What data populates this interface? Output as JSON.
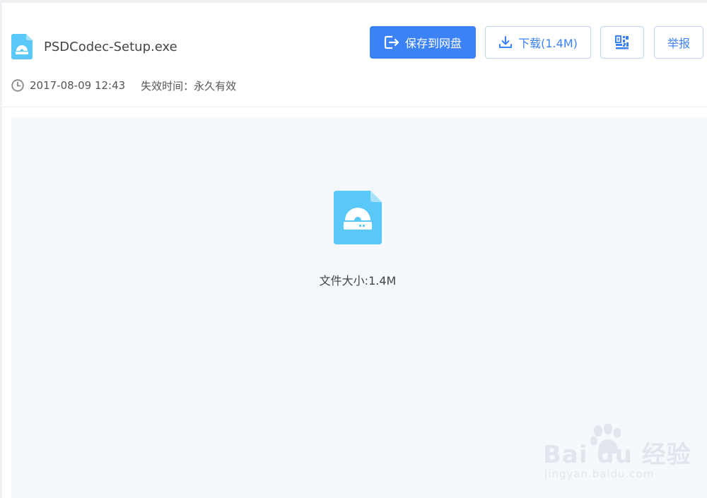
{
  "file": {
    "name": "PSDCodec-Setup.exe",
    "icon": "exe-file-icon",
    "date": "2017-08-09 12:43",
    "expire": "失效时间：永久有效",
    "size_text": "文件大小:1.4M"
  },
  "toolbar": {
    "save_label": "保存到网盘",
    "download_label": "下载(1.4M)",
    "report_label": "举报"
  },
  "colors": {
    "primary": "#3b82f6",
    "file_icon": "#5ac8f8",
    "preview_bg": "#f5f8fd"
  },
  "watermark": {
    "main": "Bai du 经验",
    "sub": "jingyan.baidu.com"
  }
}
